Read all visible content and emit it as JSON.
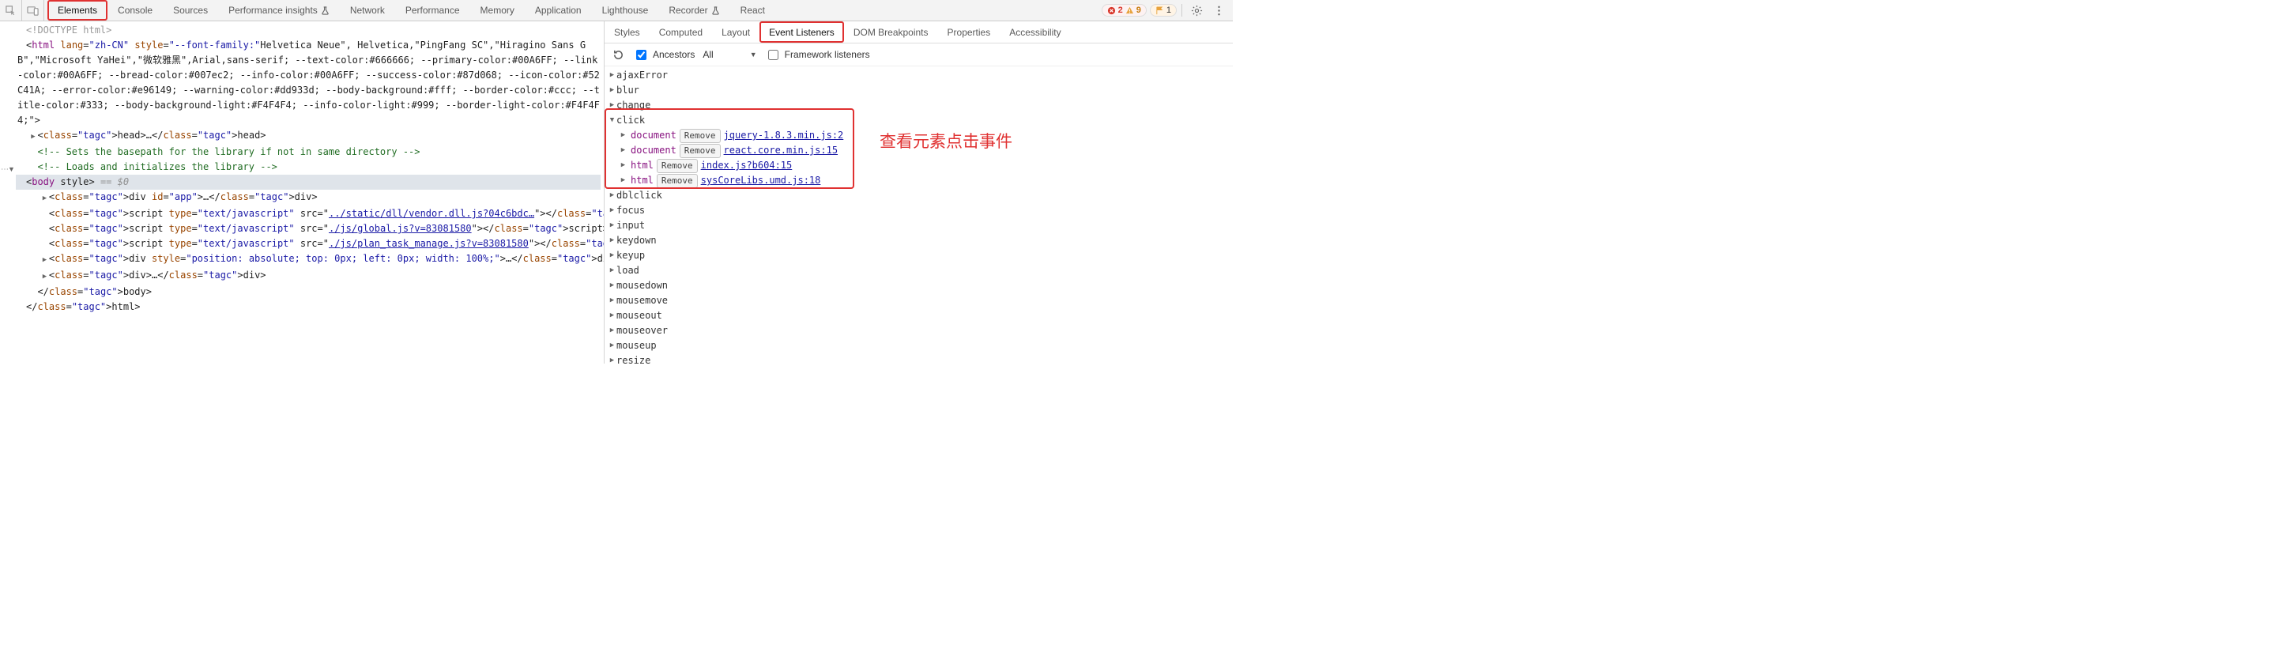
{
  "tabs": {
    "main": [
      "Elements",
      "Console",
      "Sources",
      "Performance insights",
      "Network",
      "Performance",
      "Memory",
      "Application",
      "Lighthouse",
      "Recorder",
      "React"
    ],
    "activeIndex": 0,
    "hiliteIndex": 0,
    "betaIndices": [
      3,
      9
    ]
  },
  "topright": {
    "errors": "2",
    "warnings": "9",
    "issues": "1"
  },
  "dom": {
    "doctype": "<!DOCTYPE html>",
    "htmlOpen": {
      "pre": "<",
      "tag": "html",
      "rest": " lang=\"zh-CN\" style=\"--font-family:\"Helvetica Neue\", Helvetica,\"PingFang SC\",\"Hiragino Sans GB\",\"Microsoft YaHei\",\"微软雅黑\",Arial,sans-serif; --text-color:#666666; --primary-color:#00A6FF; --link-color:#00A6FF; --bread-color:#007ec2; --info-color:#00A6FF; --success-color:#87d068; --icon-color:#52C41A; --error-color:#e96149; --warning-color:#dd933d; --body-background:#fff; --border-color:#ccc; --title-color:#333; --body-background-light:#F4F4F4; --info-color-light:#999; --border-light-color:#F4F4F4;\">"
    },
    "head": {
      "open": "<head>",
      "ell": "…",
      "close": "</head>"
    },
    "cmt1": "<!-- Sets the basepath for the library if not in same directory -->",
    "cmt2": "<!-- Loads and initializes the library -->",
    "bodyOpen": {
      "pre": "<",
      "tag": "body",
      "rest": " style>",
      "selflag": " == $0"
    },
    "app": {
      "pre": "<",
      "tag": "div",
      "attr": " id=\"app\">",
      "ell": "…",
      "close": "</div>"
    },
    "scripts": [
      {
        "prefix": "<script type=\"text/javascript\" src=\"",
        "src": "../static/dll/vendor.dll.js?04c6bdc…",
        "suffix": "\"></script>"
      },
      {
        "prefix": "<script type=\"text/javascript\" src=\"",
        "src": "./js/global.js?v=83081580",
        "suffix": "\"></script>"
      },
      {
        "prefix": "<script type=\"text/javascript\" src=\"",
        "src": "./js/plan_task_manage.js?v=83081580",
        "suffix": "\"></script>"
      }
    ],
    "absdiv": {
      "pre": "<",
      "tag": "div",
      "attr": " style=\"position: absolute; top: 0px; left: 0px; width: 100%;\">",
      "ell": "…",
      "close": "</div>"
    },
    "blankdiv": {
      "pre": "<",
      "tag": "div",
      "attr": ">",
      "ell": "…",
      "close": "</div>"
    },
    "bodyClose": "</body>",
    "htmlClose": "</html>"
  },
  "subtabs": {
    "items": [
      "Styles",
      "Computed",
      "Layout",
      "Event Listeners",
      "DOM Breakpoints",
      "Properties",
      "Accessibility"
    ],
    "activeIndex": 3,
    "hiliteIndex": 3
  },
  "evtoolbar": {
    "ancestors": "Ancestors",
    "filter": "All",
    "framework": "Framework listeners"
  },
  "events": {
    "before": [
      "ajaxError",
      "blur",
      "change"
    ],
    "open": {
      "name": "click",
      "items": [
        {
          "scope": "document",
          "remove": "Remove",
          "link": "jquery-1.8.3.min.js:2"
        },
        {
          "scope": "document",
          "remove": "Remove",
          "link": "react.core.min.js:15"
        },
        {
          "scope": "html",
          "remove": "Remove",
          "link": "index.js?b604:15"
        },
        {
          "scope": "html",
          "remove": "Remove",
          "link": "sysCoreLibs.umd.js:18"
        }
      ]
    },
    "after": [
      "dblclick",
      "focus",
      "input",
      "keydown",
      "keyup",
      "load",
      "mousedown",
      "mousemove",
      "mouseout",
      "mouseover",
      "mouseup",
      "resize"
    ]
  },
  "annotation": "查看元素点击事件"
}
